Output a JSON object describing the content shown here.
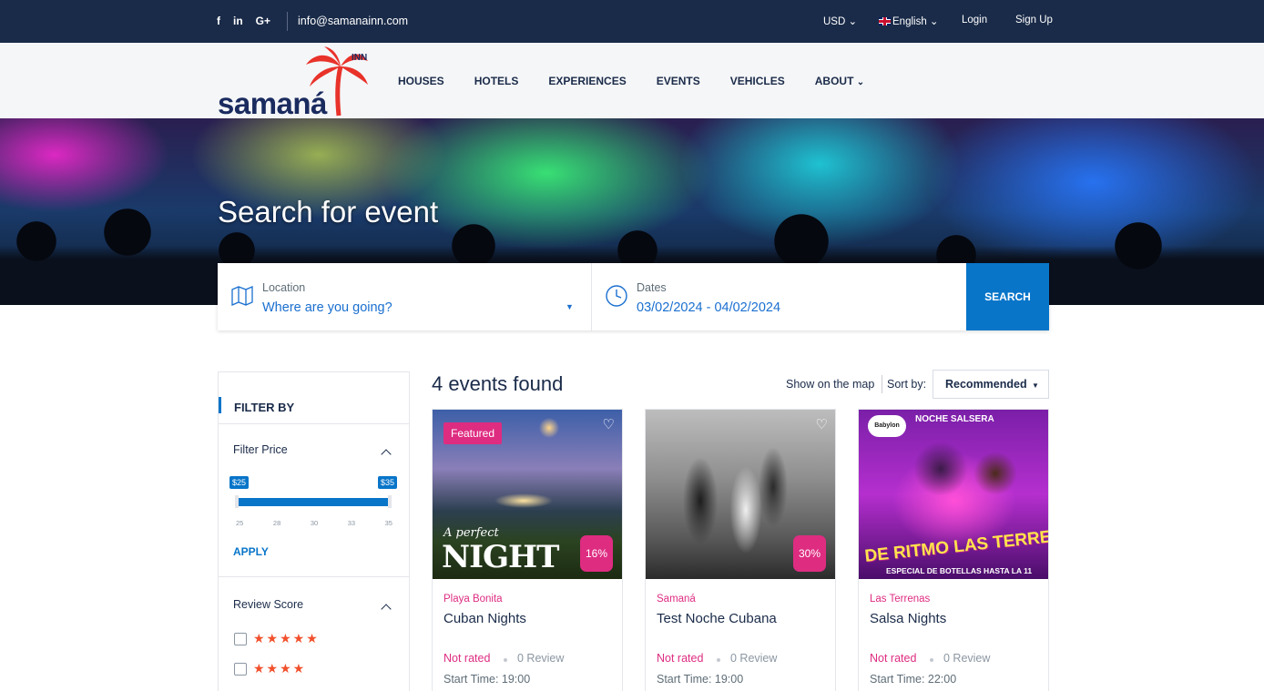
{
  "topbar": {
    "social": [
      "f",
      "in",
      "G+"
    ],
    "email": "info@samanainn.com",
    "currency": "USD",
    "language": "English",
    "login": "Login",
    "signup": "Sign Up"
  },
  "logo": {
    "word": "samaná",
    "suffix": "INN"
  },
  "nav": [
    "HOUSES",
    "HOTELS",
    "EXPERIENCES",
    "EVENTS",
    "VEHICLES",
    "ABOUT"
  ],
  "hero": {
    "title": "Search for event"
  },
  "search": {
    "location_label": "Location",
    "location_placeholder": "Where are you going?",
    "dates_label": "Dates",
    "dates_value": "03/02/2024 - 04/02/2024",
    "button": "SEARCH"
  },
  "filter": {
    "title": "FILTER BY",
    "price_title": "Filter Price",
    "price_min": "$25",
    "price_max": "$35",
    "range_fraction": [
      0.0,
      1.0
    ],
    "ticks": [
      "25",
      "28",
      "30",
      "33",
      "35"
    ],
    "apply": "APPLY",
    "review_title": "Review Score",
    "review_rows": [
      5,
      4
    ]
  },
  "results": {
    "title": "4 events found",
    "show_map": "Show on the map",
    "sort_label": "Sort by:",
    "sort_value": "Recommended"
  },
  "cards": [
    {
      "badge": "Featured",
      "discount": "16%",
      "location": "Playa Bonita",
      "name": "Cuban Nights",
      "rating": "Not rated",
      "reviews": "0 Review",
      "start": "Start Time: 19:00",
      "overlay_small": "A perfect",
      "overlay_big": "NIGHT"
    },
    {
      "badge": "",
      "discount": "30%",
      "location": "Samaná",
      "name": "Test Noche Cubana",
      "rating": "Not rated",
      "reviews": "0 Review",
      "start": "Start Time: 19:00"
    },
    {
      "badge": "",
      "discount": "",
      "location": "Las Terrenas",
      "name": "Salsa Nights",
      "rating": "Not rated",
      "reviews": "0 Review",
      "start": "Start Time: 22:00",
      "overlay_top": "NOCHE SALSERA",
      "overlay_mid": "DE RITMO LAS TERRENAS",
      "overlay_bottom": "ESPECIAL DE BOTELLAS HASTA LA 11",
      "overlay_badge": "Babylon"
    }
  ],
  "colors": {
    "navy": "#1a2b49",
    "blue": "#0875c9",
    "pink": "#de2c81",
    "star": "#f1502c"
  }
}
